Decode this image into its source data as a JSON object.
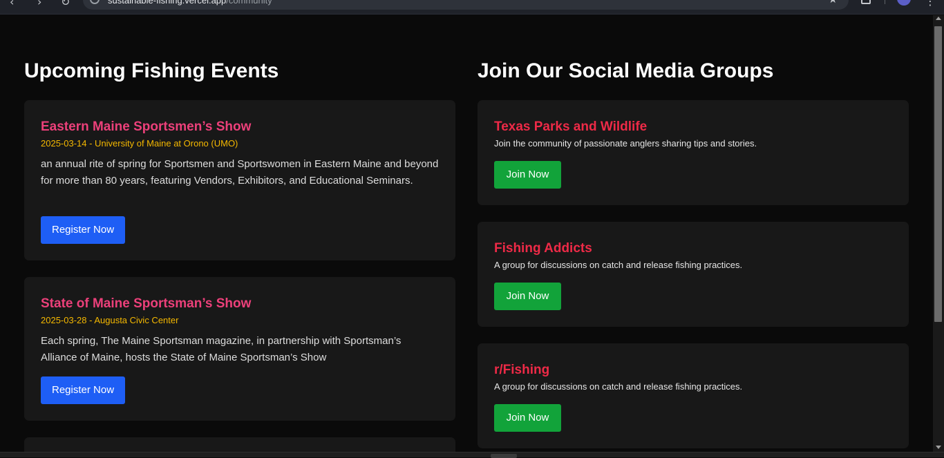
{
  "browser": {
    "url_host": "sustainable-fishing.vercel.app",
    "url_path": "/community"
  },
  "events": {
    "heading": "Upcoming Fishing Events",
    "items": [
      {
        "title": "Eastern Maine Sportsmen’s Show",
        "meta": "2025-03-14 - University of Maine at Orono (UMO)",
        "description": "an annual rite of spring for Sportsmen and Sportswomen in Eastern Maine and beyond for more than 80 years, featuring Vendors, Exhibitors, and Educational Seminars.",
        "button": "Register Now"
      },
      {
        "title": "State of Maine Sportsman’s Show",
        "meta": "2025-03-28 - Augusta Civic Center",
        "description": "Each spring, The Maine Sportsman magazine, in partnership with Sportsman’s Alliance of Maine, hosts the State of Maine Sportsman’s Show",
        "button": "Register Now"
      }
    ]
  },
  "groups": {
    "heading": "Join Our Social Media Groups",
    "items": [
      {
        "name": "Texas Parks and Wildlife",
        "description": "Join the community of passionate anglers sharing tips and stories.",
        "button": "Join Now"
      },
      {
        "name": "Fishing Addicts",
        "description": "A group for discussions on catch and release fishing practices.",
        "button": "Join Now"
      },
      {
        "name": "r/Fishing",
        "description": "A group for discussions on catch and release fishing practices.",
        "button": "Join Now"
      }
    ]
  },
  "colors": {
    "background": "#0a0a0a",
    "card": "#181818",
    "event_title": "#ec407a",
    "event_meta": "#f5b800",
    "group_title": "#ee2a47",
    "register_button": "#1e5ef5",
    "join_button": "#12a33a"
  }
}
